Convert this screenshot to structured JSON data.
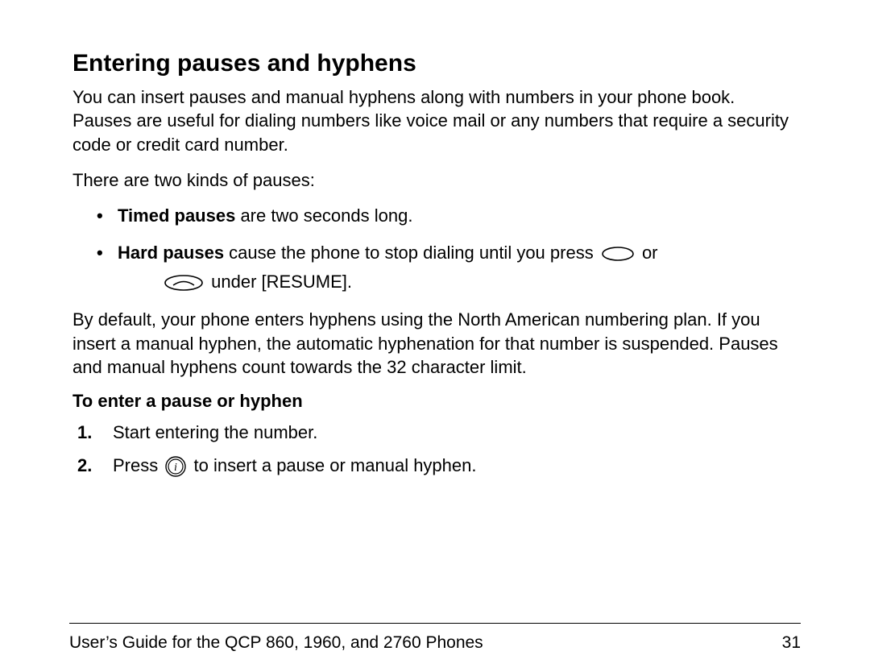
{
  "heading": "Entering pauses and hyphens",
  "intro": "You can insert pauses and manual hyphens along with numbers in your phone book. Pauses are useful for dialing numbers like voice mail or any numbers that require a security code or credit card number.",
  "two_kinds": "There are two kinds of pauses:",
  "bullets": {
    "timed_label": "Timed pauses",
    "timed_rest": " are two seconds long.",
    "hard_label": "Hard pauses",
    "hard_rest_before_icon": " cause the phone to stop dialing until you press ",
    "hard_rest_or": " or",
    "hard_rest_after": " under [RESUME]."
  },
  "default_para": "By default, your phone enters hyphens using the North American numbering plan. If you insert a manual hyphen, the automatic hyphenation for that number is suspended. Pauses and manual hyphens count towards the 32 character limit.",
  "subheading": "To enter a pause or hyphen",
  "steps": {
    "s1": "Start entering the number.",
    "s2_before": "Press ",
    "s2_after": " to insert a pause or manual hyphen."
  },
  "footer_left": "User’s Guide for the QCP 860, 1960, and 2760 Phones",
  "footer_right": "31"
}
